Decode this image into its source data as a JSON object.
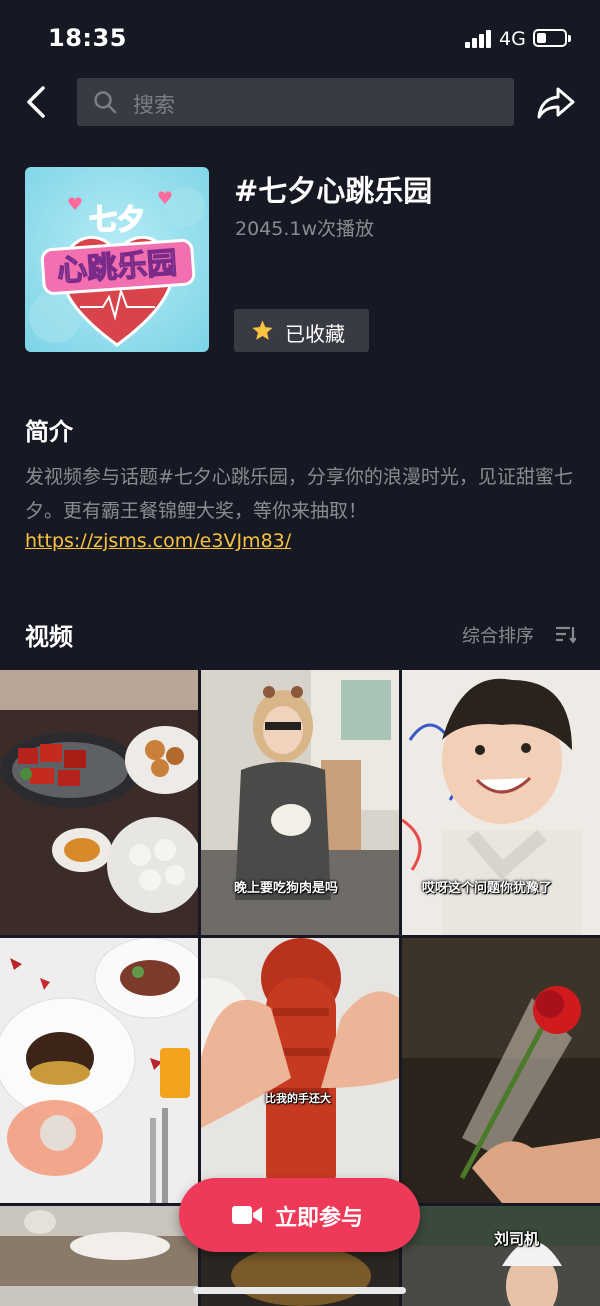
{
  "status_bar": {
    "time": "18:35",
    "network": "4G",
    "battery_level": 0.35
  },
  "header": {
    "search_placeholder": "搜索",
    "back_icon": "chevron-left-icon",
    "share_icon": "share-arrow-icon"
  },
  "topic": {
    "title": "#七夕心跳乐园",
    "plays": "2045.1w次播放",
    "favorite_label": "已收藏",
    "cover_text": "心跳乐园",
    "cover_top_text": "七夕"
  },
  "intro": {
    "heading": "简介",
    "text": "发视频参与话题#七夕心跳乐园，分享你的浪漫时光，见证甜蜜七夕。更有霸王餐锦鲤大奖，等你来抽取！",
    "link": "https://zjsms.com/e3VJm83/"
  },
  "videos": {
    "heading": "视频",
    "sort_label": "综合排序",
    "captions": {
      "v2": "晚上要吃狗肉是吗",
      "v3": "哎呀这个问题你犹豫了",
      "v5": "比我的手还大",
      "v9": "刘司机"
    }
  },
  "join_button": {
    "label": "立即参与",
    "icon": "video-camera-icon"
  },
  "colors": {
    "background": "#161823",
    "accent": "#ee3a58",
    "link": "#f8c33f",
    "muted": "#8a8b91",
    "field": "#393b44"
  }
}
